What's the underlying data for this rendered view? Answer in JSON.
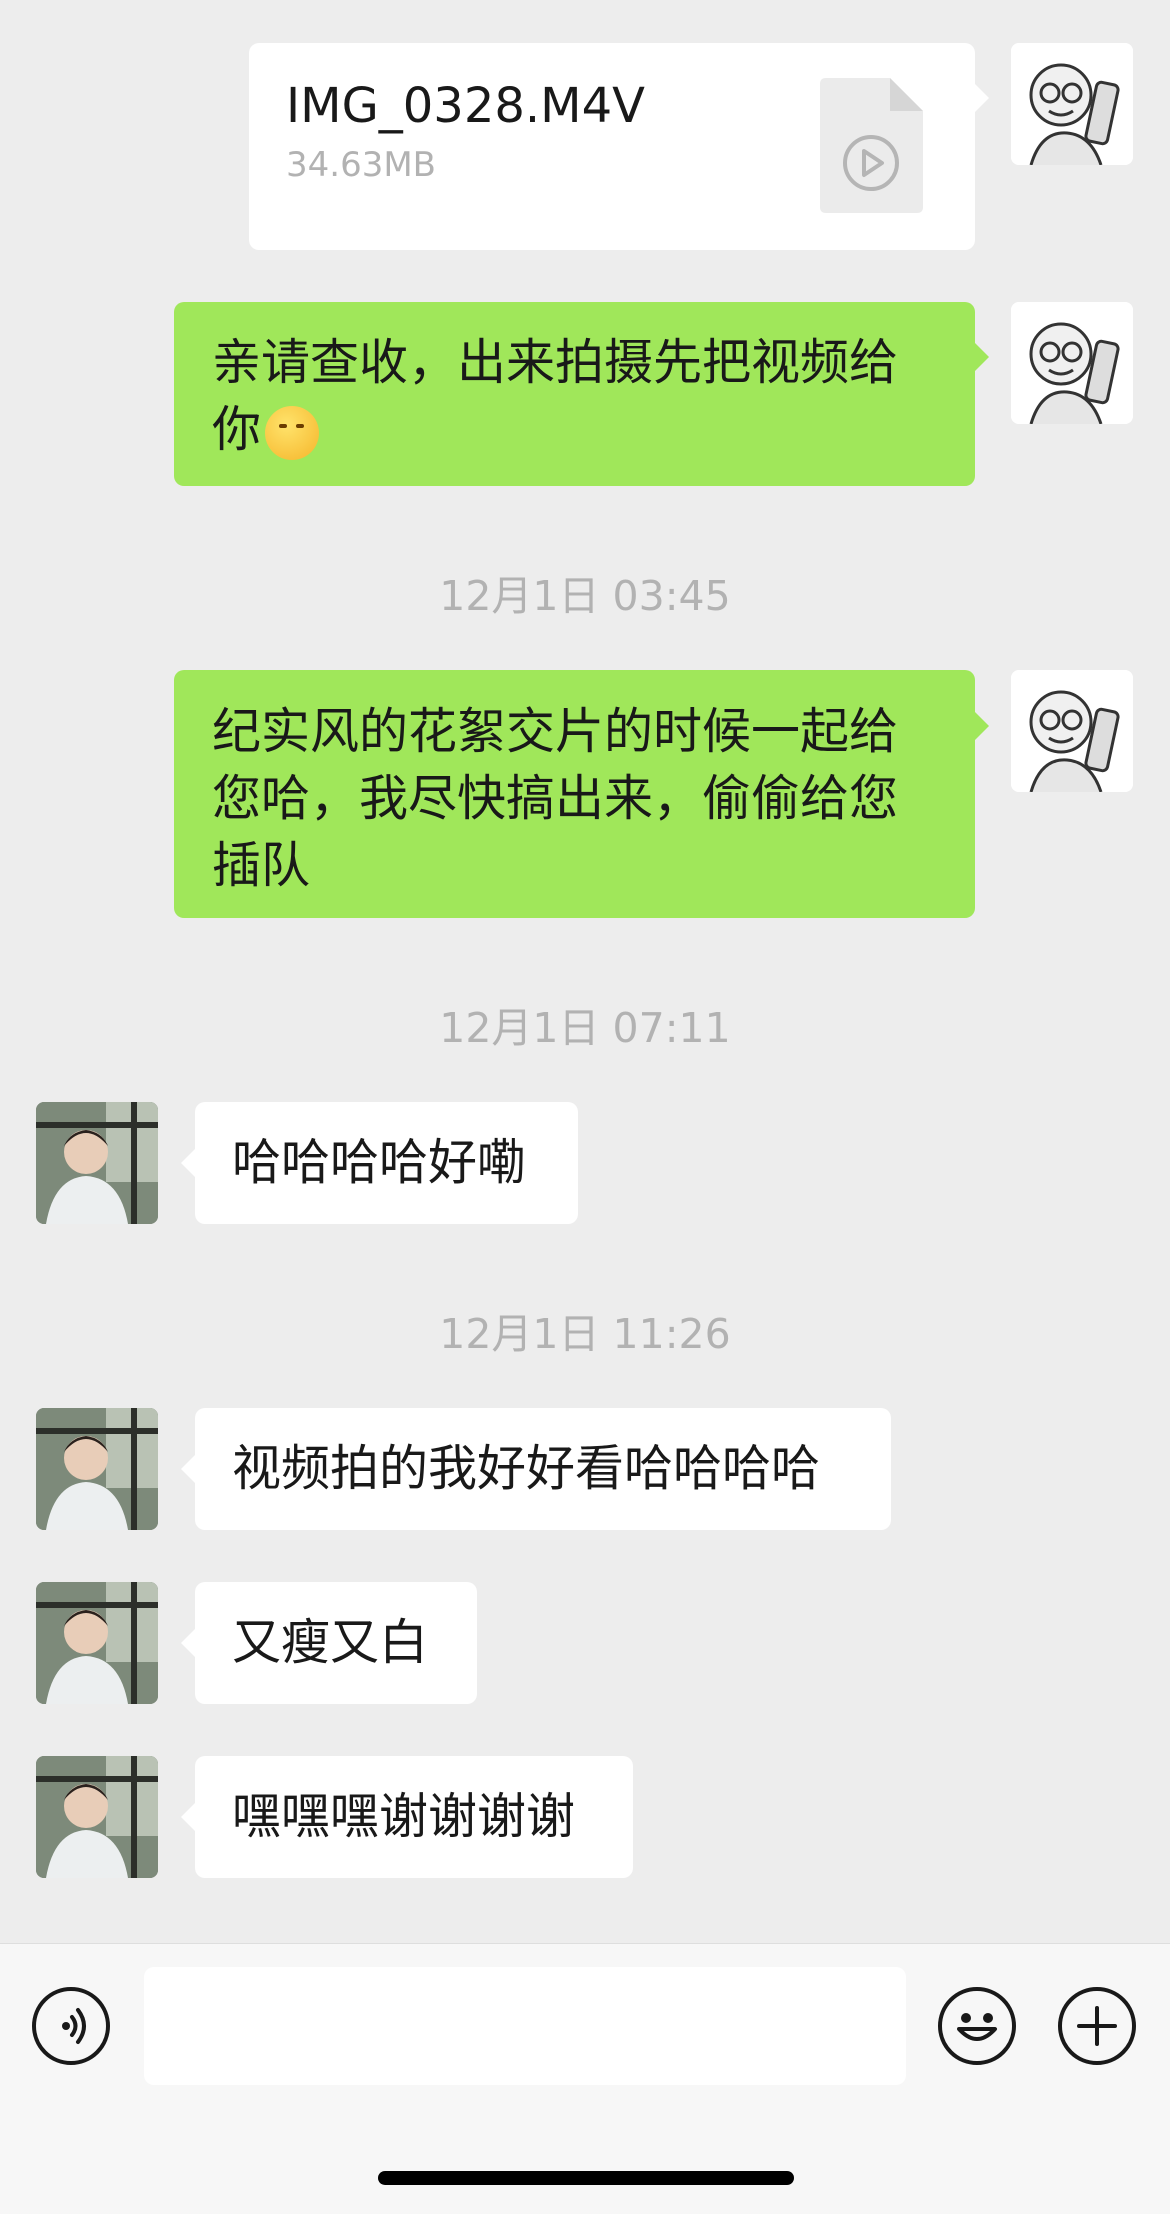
{
  "file_message": {
    "name": "IMG_0328.M4V",
    "size": "34.63MB"
  },
  "messages": [
    {
      "text": "亲请查收，出来拍摄先把视频给你"
    },
    {
      "timestamp": "12月1日 03:45"
    },
    {
      "text": "纪实风的花絮交片的时候一起给您哈，我尽快搞出来，偷偷给您插队"
    },
    {
      "timestamp": "12月1日 07:11"
    },
    {
      "text": "哈哈哈哈好嘞"
    },
    {
      "timestamp": "12月1日 11:26"
    },
    {
      "text": "视频拍的我好好看哈哈哈哈"
    },
    {
      "text": "又瘦又白"
    },
    {
      "text": "嘿嘿嘿谢谢谢谢"
    }
  ],
  "icons": {
    "voice": "voice-icon",
    "emoji": "emoji-icon",
    "plus": "plus-icon",
    "play": "play-icon"
  },
  "colors": {
    "sent_bubble": "#a0e75a",
    "received_bubble": "#ffffff",
    "background": "#ededed"
  }
}
